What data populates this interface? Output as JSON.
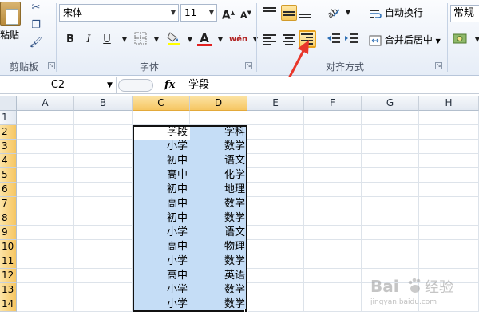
{
  "clipboard": {
    "paste_label": "粘贴",
    "group_label": "剪贴板"
  },
  "font": {
    "font_name": "宋体",
    "font_size": "11",
    "grow_label": "A",
    "shrink_label": "A",
    "bold": "B",
    "italic": "I",
    "underline": "U",
    "font_color_letter": "A",
    "phonetic_label": "wén",
    "group_label": "字体"
  },
  "alignment": {
    "wrap_text_label": "自动换行",
    "merge_center_label": "合并后居中",
    "group_label": "对齐方式",
    "active_button": "align-right"
  },
  "number": {
    "format_value": "常规"
  },
  "formula_bar": {
    "name_box": "C2",
    "fx_label": "fx",
    "content": "学段"
  },
  "columns": [
    "A",
    "B",
    "C",
    "D",
    "E",
    "F",
    "G",
    "H"
  ],
  "selected_columns": [
    "C",
    "D"
  ],
  "rows": [
    "1",
    "2",
    "3",
    "4",
    "5",
    "6",
    "7",
    "8",
    "9",
    "10",
    "11",
    "12",
    "13",
    "14"
  ],
  "table": {
    "header": [
      "学段",
      "学科"
    ],
    "data": [
      [
        "小学",
        "数学"
      ],
      [
        "初中",
        "语文"
      ],
      [
        "高中",
        "化学"
      ],
      [
        "初中",
        "地理"
      ],
      [
        "高中",
        "数学"
      ],
      [
        "初中",
        "数学"
      ],
      [
        "小学",
        "语文"
      ],
      [
        "高中",
        "物理"
      ],
      [
        "小学",
        "数学"
      ],
      [
        "高中",
        "英语"
      ],
      [
        "小学",
        "数学"
      ],
      [
        "小学",
        "数学"
      ]
    ]
  },
  "watermark": {
    "brand": "Bai",
    "chinese": "经验",
    "url": "jingyan.baidu.com"
  },
  "colors": {
    "selection_fill": "#c5ddf6",
    "header_highlight": "#f6c662",
    "arrow_red": "#e8372b",
    "active_button": "#f7c75a"
  }
}
